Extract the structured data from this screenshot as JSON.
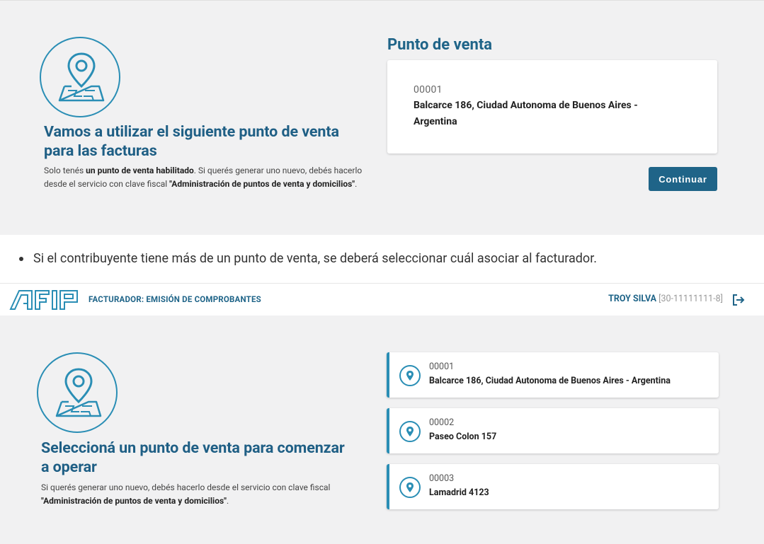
{
  "screen1": {
    "heading_line1": "Vamos a utilizar el siguiente punto de venta",
    "heading_line2": "para las facturas",
    "desc_part1": "Solo tenés ",
    "desc_bold1": "un punto de venta habilitado",
    "desc_part2": ". Si querés generar uno nuevo, debés hacerlo desde el servicio con clave fiscal ",
    "desc_bold2": "\"Administración de puntos de venta y domicilios\"",
    "desc_part3": ".",
    "section_title": "Punto de venta",
    "card_number": "00001",
    "card_address": "Balcarce 186, Ciudad Autonoma de Buenos Aires - Argentina",
    "continue_label": "Continuar"
  },
  "bullet": {
    "text": "Si el contribuyente tiene más de un punto de venta, se deberá seleccionar cuál asociar al facturador."
  },
  "header": {
    "logo_text": "AFIP",
    "app_title": "FACTURADOR: EMISIÓN DE COMPROBANTES",
    "user_name": "TROY SILVA",
    "user_cuit": "[30-11111111-8]",
    "logout_icon": "logout-icon"
  },
  "screen2": {
    "heading_line1": "Seleccioná un punto de venta para comenzar",
    "heading_line2": "a operar",
    "desc_part1": "Si querés generar uno nuevo, debés hacerlo desde el servicio con clave fiscal ",
    "desc_bold": "\"Administración de puntos de venta y domicilios\"",
    "desc_part2": ".",
    "points": [
      {
        "number": "00001",
        "address": "Balcarce 186, Ciudad Autonoma de Buenos Aires - Argentina"
      },
      {
        "number": "00002",
        "address": "Paseo Colon 157"
      },
      {
        "number": "00003",
        "address": "Lamadrid 4123"
      }
    ]
  },
  "colors": {
    "accent": "#1f6488",
    "accent_light": "#2a8eb5",
    "panel_bg": "#f1f1f2"
  }
}
